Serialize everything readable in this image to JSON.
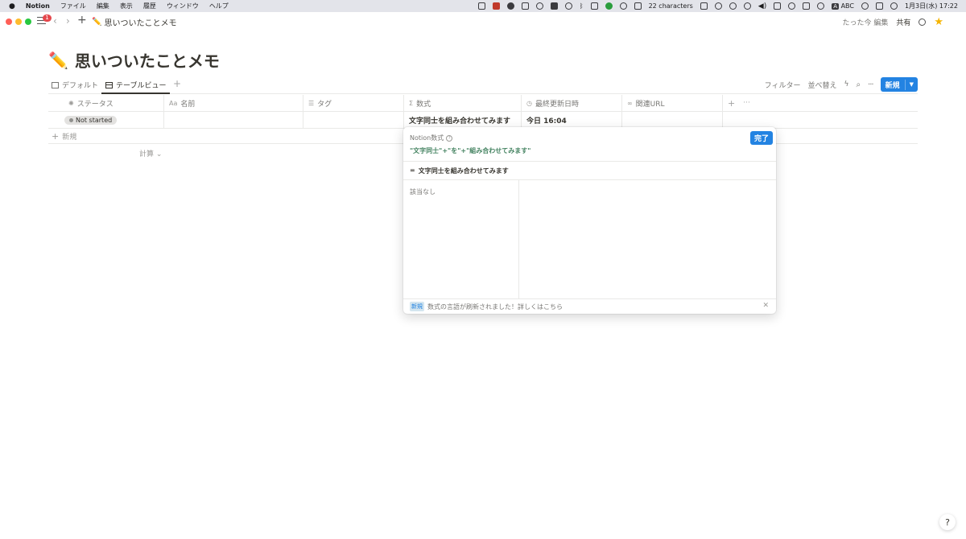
{
  "menubar": {
    "app": "Notion",
    "menus": [
      "ファイル",
      "編集",
      "表示",
      "履歴",
      "ウィンドウ",
      "ヘルプ"
    ],
    "status": {
      "characters": "22 characters",
      "input": "ABC",
      "datetime": "1月3日(水) 17:22"
    }
  },
  "titlebar": {
    "badge": "1",
    "breadcrumb_icon": "✏️",
    "breadcrumb": "思いついたことメモ",
    "edited": "たった今 編集",
    "share": "共有"
  },
  "page": {
    "icon": "✏️",
    "title": "思いついたことメモ"
  },
  "views": {
    "tabs": [
      "デフォルト",
      "テーブルビュー"
    ],
    "active": 1,
    "tools": {
      "filter": "フィルター",
      "sort": "並べ替え",
      "new": "新規"
    }
  },
  "table": {
    "headers": [
      {
        "icon": "loader-icon",
        "label": "ステータス"
      },
      {
        "icon": "text-icon",
        "label": "名前",
        "prefix": "Aa"
      },
      {
        "icon": "list-icon",
        "label": "タグ"
      },
      {
        "icon": "sigma-icon",
        "label": "数式",
        "prefix": "Σ"
      },
      {
        "icon": "clock-icon",
        "label": "最終更新日時"
      },
      {
        "icon": "link-icon",
        "label": "関連URL"
      }
    ],
    "row": {
      "status": "Not started",
      "formula": "文字同士を組み合わせてみます",
      "updated": "今日 16:04"
    },
    "add_row": "新規",
    "calc": "計算"
  },
  "formula_popup": {
    "title": "Notion数式",
    "done": "完了",
    "expression": "\"文字同士\"+\"を\"+\"組み合わせてみます\"",
    "result_prefix": "=",
    "result": "文字同士を組み合わせてみます",
    "no_match": "該当なし",
    "footer_tag": "新規",
    "footer_text": "数式の言語が刷新されました！詳しくはこちら"
  },
  "help": "?",
  "colors": {
    "accent": "#2383e2",
    "formula_green": "#448361",
    "close": "#ff5f57",
    "minimize": "#febc2e",
    "zoom": "#28c840"
  }
}
